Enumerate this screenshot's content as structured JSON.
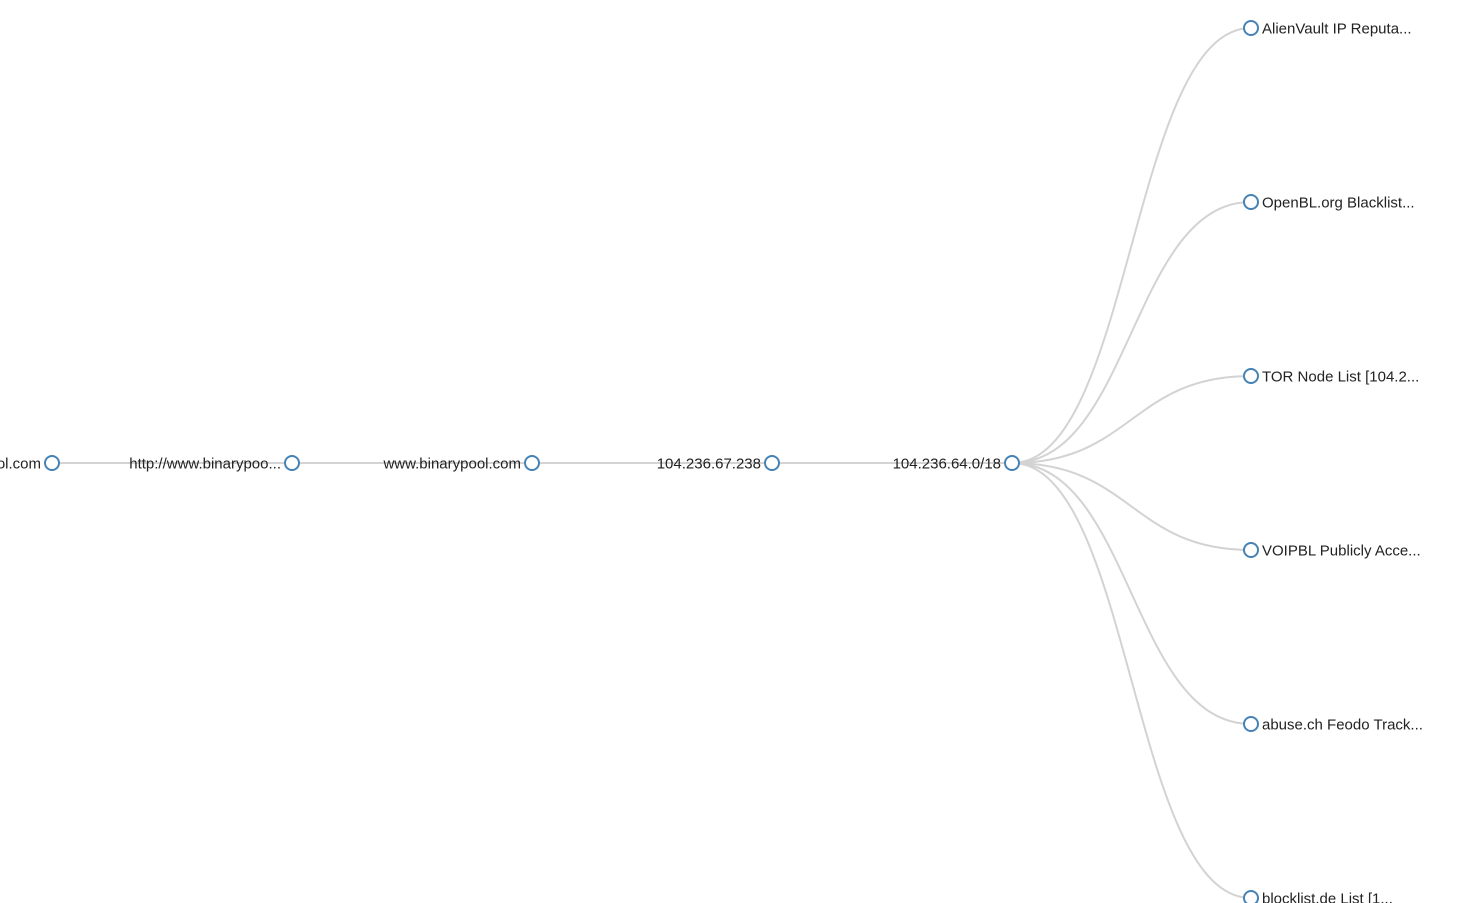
{
  "tree": {
    "link_color": "#d3d3d3",
    "node_stroke_color": "#4682b4",
    "node_fill_color": "#ffffff",
    "label_color": "#222222",
    "nodes": [
      {
        "id": "root",
        "label": "binarypool.com",
        "parent": null,
        "label_side": "left"
      },
      {
        "id": "url",
        "label": "http://www.binarypoo...",
        "parent": "root",
        "label_side": "left"
      },
      {
        "id": "host",
        "label": "www.binarypool.com",
        "parent": "url",
        "label_side": "left"
      },
      {
        "id": "ip",
        "label": "104.236.67.238",
        "parent": "host",
        "label_side": "left"
      },
      {
        "id": "subnet",
        "label": "104.236.64.0/18",
        "parent": "ip",
        "label_side": "left"
      },
      {
        "id": "feed-alienvault",
        "label": "AlienVault IP Reputa...",
        "parent": "subnet",
        "label_side": "right"
      },
      {
        "id": "feed-openbl",
        "label": "OpenBL.org Blacklist...",
        "parent": "subnet",
        "label_side": "right"
      },
      {
        "id": "feed-tor",
        "label": "TOR Node List [104.2...",
        "parent": "subnet",
        "label_side": "right"
      },
      {
        "id": "feed-voipbl",
        "label": "VOIPBL Publicly Acce...",
        "parent": "subnet",
        "label_side": "right"
      },
      {
        "id": "feed-feodo",
        "label": "abuse.ch Feodo Track...",
        "parent": "subnet",
        "label_side": "right"
      },
      {
        "id": "feed-blocklist",
        "label": "blocklist.de List [1...",
        "parent": "subnet",
        "label_side": "right"
      }
    ]
  }
}
